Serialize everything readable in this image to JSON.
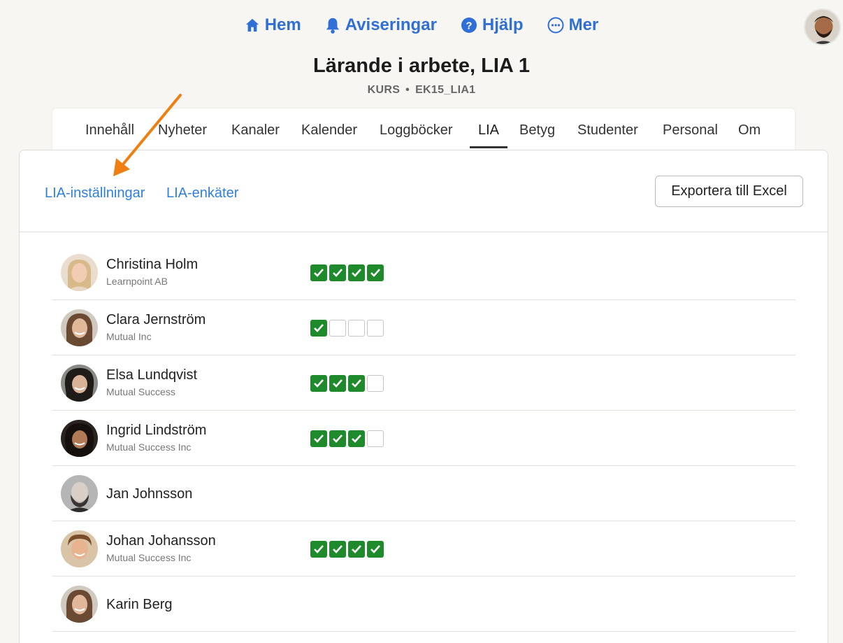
{
  "nav": {
    "items": [
      {
        "label": "Hem",
        "icon": "home-icon"
      },
      {
        "label": "Aviseringar",
        "icon": "bell-icon"
      },
      {
        "label": "Hjälp",
        "icon": "help-icon"
      },
      {
        "label": "Mer",
        "icon": "more-icon"
      }
    ],
    "accent": "#2f6fd6"
  },
  "course": {
    "title": "Lärande i arbete, LIA 1",
    "type": "KURS",
    "code": "EK15_LIA1"
  },
  "tabs": [
    "Innehåll",
    "Nyheter",
    "Kanaler",
    "Kalender",
    "Loggböcker",
    "LIA",
    "Betyg",
    "Studenter",
    "Personal",
    "Om"
  ],
  "active_tab": "LIA",
  "subnav": {
    "settings_link": "LIA-inställningar",
    "survey_link": "LIA-enkäter",
    "export_button": "Exportera till Excel"
  },
  "students": [
    {
      "name": "Christina Holm",
      "company": "Learnpoint AB",
      "checks": [
        true,
        true,
        true,
        true
      ]
    },
    {
      "name": "Clara Jernström",
      "company": "Mutual Inc",
      "checks": [
        true,
        false,
        false,
        false
      ]
    },
    {
      "name": "Elsa Lundqvist",
      "company": "Mutual Success",
      "checks": [
        true,
        true,
        true,
        false
      ]
    },
    {
      "name": "Ingrid Lindström",
      "company": "Mutual Success Inc",
      "checks": [
        true,
        true,
        true,
        false
      ]
    },
    {
      "name": "Jan Johnsson",
      "company": "",
      "checks": []
    },
    {
      "name": "Johan Johansson",
      "company": "Mutual Success Inc",
      "checks": [
        true,
        true,
        true,
        true
      ]
    },
    {
      "name": "Karin Berg",
      "company": "",
      "checks": []
    }
  ],
  "colors": {
    "check_on": "#1e8a2c",
    "link": "#2f7fe0",
    "annotation_arrow": "#f07f12"
  }
}
